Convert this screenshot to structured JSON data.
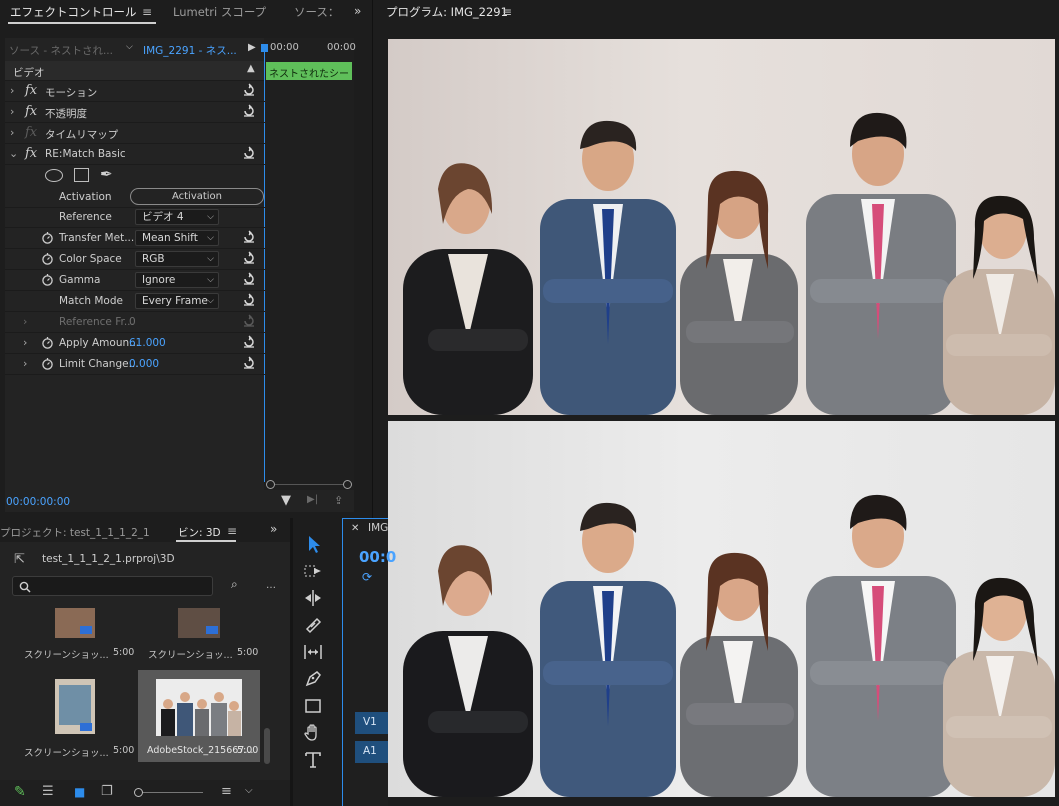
{
  "effect_controls": {
    "tabs": [
      {
        "label": "エフェクトコントロール",
        "active": true
      },
      {
        "label": "Lumetri スコープ",
        "active": false
      },
      {
        "label": "ソース：",
        "active": false
      }
    ],
    "source_selector": "ソース - ネストされ...",
    "clip_selector": "IMG_2291 - ネス...",
    "timecode_start": "00:00",
    "timecode_end": "00:00",
    "clip_label": "ネストされたシー",
    "section_video": "ビデオ",
    "effects": [
      {
        "name": "モーション"
      },
      {
        "name": "不透明度"
      },
      {
        "name": "タイムリマップ"
      },
      {
        "name": "RE:Match Basic"
      }
    ],
    "params": {
      "activation_label": "Activation",
      "activation_button": "Activation",
      "reference_label": "Reference",
      "reference_value": "ビデオ 4",
      "transfer_label": "Transfer Met...",
      "transfer_value": "Mean Shift",
      "colorspace_label": "Color Space",
      "colorspace_value": "RGB",
      "gamma_label": "Gamma",
      "gamma_value": "Ignore",
      "matchmode_label": "Match Mode",
      "matchmode_value": "Every Frame",
      "reffr_label": "Reference Fr...",
      "reffr_value": "0",
      "apply_label": "Apply Amoun...",
      "apply_value": "61.000",
      "limit_label": "Limit Change...",
      "limit_value": "0.000"
    },
    "footer_timecode": "00:00:00:00"
  },
  "program_monitor": {
    "title": "プログラム: IMG_2291"
  },
  "project_panel": {
    "tab_project": "プロジェクト: test_1_1_1_2_1",
    "tab_bin": "ビン: 3D",
    "path": "test_1_1_1_2_1.prproj\\3D",
    "search_placeholder": "",
    "items": [
      {
        "name": "スクリーンショッ...",
        "duration": "5:00"
      },
      {
        "name": "スクリーンショッ...",
        "duration": "5:00"
      },
      {
        "name": "スクリーンショッ...",
        "duration": "5:00"
      },
      {
        "name": "AdobeStock_215667...",
        "duration": "5:00"
      }
    ]
  },
  "timeline": {
    "tab_label": "IMG",
    "timecode": "00:0",
    "tracks": [
      "V1",
      "A1"
    ]
  },
  "colors": {
    "accent_blue": "#4aa3ff",
    "clip_green": "#5fbf5a",
    "selection_blue": "#2d8ceb"
  }
}
